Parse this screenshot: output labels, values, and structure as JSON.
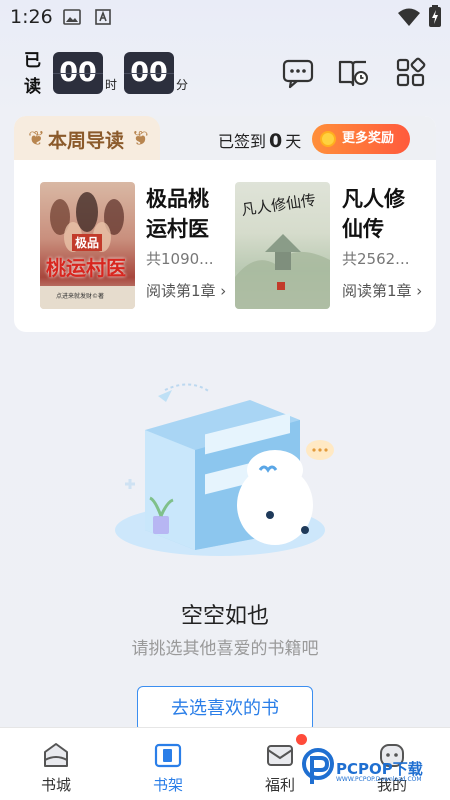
{
  "status_bar": {
    "time": "1:26"
  },
  "reading_time": {
    "label": "已读",
    "hours": "00",
    "hours_unit": "时",
    "minutes": "00",
    "minutes_unit": "分"
  },
  "weekly": {
    "tab_label": "本周导读",
    "checkin_prefix": "已签到",
    "checkin_days": "0",
    "checkin_suffix": "天",
    "reward_label": "更多奖励",
    "books": [
      {
        "title": "极品桃运村医",
        "meta": "共1090...",
        "read": "阅读第1章 ›",
        "cover_text_top": "极品",
        "cover_text_main": "桃运村医",
        "cover_author": "点进来就发财©著"
      },
      {
        "title": "凡人修仙传",
        "meta": "共2562...",
        "read": "阅读第1章 ›",
        "cover_text_main": "凡人修仙传"
      }
    ]
  },
  "empty": {
    "title": "空空如也",
    "subtitle": "请挑选其他喜爱的书籍吧",
    "button": "去选喜欢的书"
  },
  "nav": {
    "items": [
      {
        "label": "书城",
        "icon": "bookstore-icon",
        "active": false
      },
      {
        "label": "书架",
        "icon": "bookshelf-icon",
        "active": true
      },
      {
        "label": "福利",
        "icon": "welfare-envelope-icon",
        "active": false
      },
      {
        "label": "我的",
        "icon": "profile-icon",
        "active": false
      }
    ]
  },
  "watermark": {
    "text": "PCPOP下载",
    "sub": "WWW.PCPOP.Download.COM"
  },
  "colors": {
    "accent": "#2a7ee8",
    "reward": "#ff5a3c",
    "time_box": "#2c2f3d"
  }
}
